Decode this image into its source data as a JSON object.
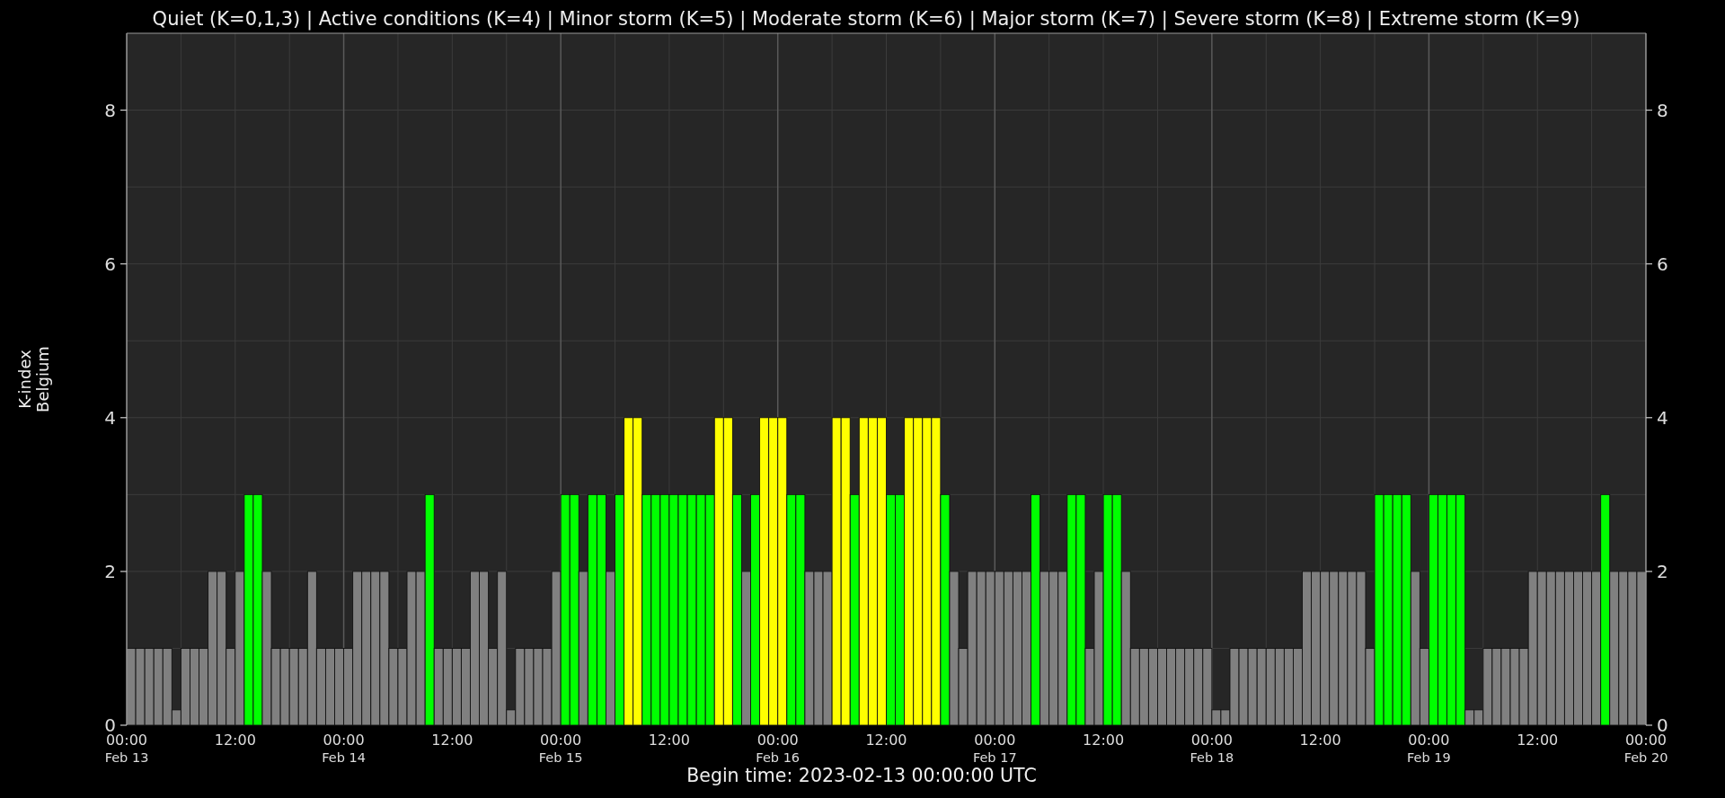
{
  "chart": {
    "chart_data": {
      "type": "bar",
      "title": "Quiet (K=0,1,3) | Active conditions (K=4) | Minor storm (K=5) | Moderate storm (K=6) | Major storm (K=7) | Severe storm (K=8) | Extreme storm (K=9)",
      "xlabel": "Begin time: 2023-02-13 00:00:00 UTC",
      "ylabel": "K-index\nBelgium",
      "values": [
        1,
        1,
        1,
        1,
        1,
        0.2,
        1,
        1,
        1,
        2,
        2,
        1,
        2,
        3,
        3,
        2,
        1,
        1,
        1,
        1,
        2,
        1,
        1,
        1,
        1,
        2,
        2,
        2,
        2,
        1,
        1,
        2,
        2,
        3,
        1,
        1,
        1,
        1,
        2,
        2,
        1,
        2,
        0.2,
        1,
        1,
        1,
        1,
        2,
        3,
        3,
        2,
        3,
        3,
        2,
        3,
        4,
        4,
        3,
        3,
        3,
        3,
        3,
        3,
        3,
        3,
        4,
        4,
        3,
        2,
        3,
        4,
        4,
        4,
        3,
        3,
        2,
        2,
        2,
        4,
        4,
        3,
        4,
        4,
        4,
        3,
        3,
        4,
        4,
        4,
        4,
        3,
        2,
        1,
        2,
        2,
        2,
        2,
        2,
        2,
        2,
        3,
        2,
        2,
        2,
        3,
        3,
        1,
        2,
        3,
        3,
        2,
        1,
        1,
        1,
        1,
        1,
        1,
        1,
        1,
        1,
        0.2,
        0.2,
        1,
        1,
        1,
        1,
        1,
        1,
        1,
        1,
        2,
        2,
        2,
        2,
        2,
        2,
        2,
        1,
        3,
        3,
        3,
        3,
        2,
        1,
        3,
        3,
        3,
        3,
        0.2,
        0.2,
        1,
        1,
        1,
        1,
        1,
        2,
        2,
        2,
        2,
        2,
        2,
        2,
        2,
        3,
        2,
        2,
        2,
        2
      ],
      "categories": [
        "00:00\nFeb 13",
        null,
        null,
        null,
        null,
        null,
        null,
        null,
        null,
        null,
        null,
        null,
        "12:00",
        null,
        null,
        null,
        null,
        null,
        null,
        null,
        null,
        null,
        null,
        null,
        "00:00\nFeb 14",
        null,
        null,
        null,
        null,
        null,
        null,
        null,
        null,
        null,
        null,
        null,
        "12:00",
        null,
        null,
        null,
        null,
        null,
        null,
        null,
        null,
        null,
        null,
        null,
        "00:00\nFeb 15",
        null,
        null,
        null,
        null,
        null,
        null,
        null,
        null,
        null,
        null,
        null,
        "12:00",
        null,
        null,
        null,
        null,
        null,
        null,
        null,
        null,
        null,
        null,
        null,
        "00:00\nFeb 16",
        null,
        null,
        null,
        null,
        null,
        null,
        null,
        null,
        null,
        null,
        null,
        "12:00",
        null,
        null,
        null,
        null,
        null,
        null,
        null,
        null,
        null,
        null,
        null,
        "00:00\nFeb 17",
        null,
        null,
        null,
        null,
        null,
        null,
        null,
        null,
        null,
        null,
        null,
        "12:00",
        null,
        null,
        null,
        null,
        null,
        null,
        null,
        null,
        null,
        null,
        null,
        "00:00\nFeb 18",
        null,
        null,
        null,
        null,
        null,
        null,
        null,
        null,
        null,
        null,
        null,
        "12:00",
        null,
        null,
        null,
        null,
        null,
        null,
        null,
        null,
        null,
        null,
        null,
        "00:00\nFeb 19",
        null,
        null,
        null,
        null,
        null,
        null,
        null,
        null,
        null,
        null,
        null,
        "12:00",
        null,
        null,
        null,
        null,
        null,
        null,
        null,
        null,
        null,
        null,
        null
      ],
      "grid": true,
      "ylim": [
        0,
        9
      ],
      "yticks": [
        0,
        2,
        4,
        6,
        8
      ]
    },
    "x_axis_end_label": "00:00\nFeb 20",
    "right_scale_numbers": [
      "8",
      "6",
      "4",
      "2",
      "0"
    ]
  }
}
